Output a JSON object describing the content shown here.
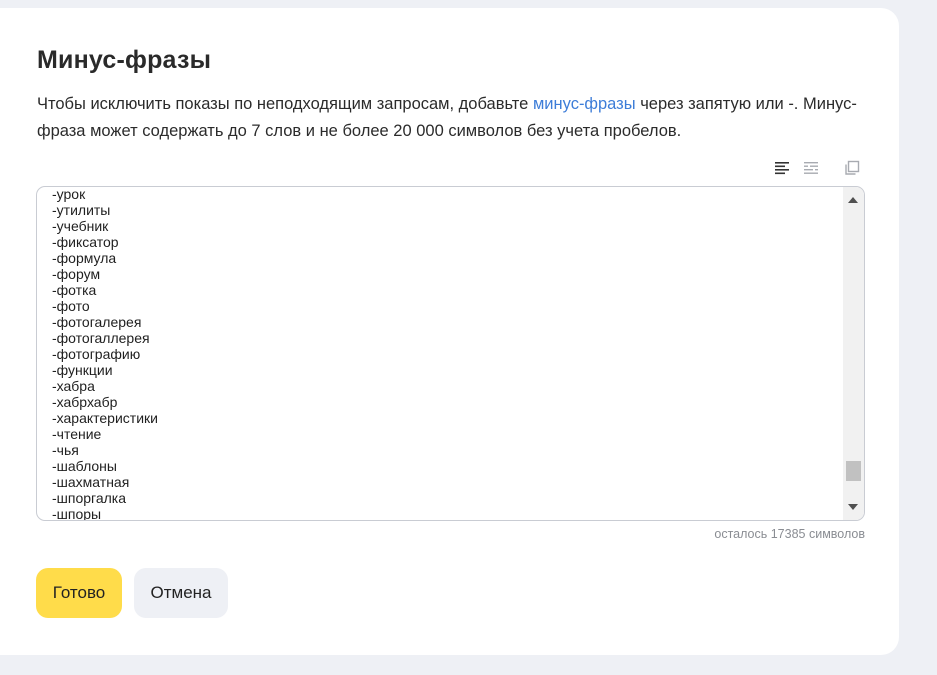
{
  "dialog": {
    "title": "Минус-фразы",
    "description_before": "Чтобы исключить показы по неподходящим запросам, добавьте ",
    "description_link": "минус-фразы",
    "description_after": " через запятую или -. Минус-фраза может содержать до 7 слов и не более 20 000 символов без учета пробелов."
  },
  "toolbar": {
    "icons": [
      "align-list-icon",
      "align-inline-icon",
      "copy-icon"
    ]
  },
  "editor": {
    "lines": [
      "-урок",
      "-утилиты",
      "-учебник",
      "-фиксатор",
      "-формула",
      "-форум",
      "-фотка",
      "-фото",
      "-фотогалерея",
      "-фотогаллерея",
      "-фотографию",
      "-функции",
      "-хабра",
      "-хабрхабр",
      "-характеристики",
      "-чтение",
      "-чья",
      "-шаблоны",
      "-шахматная",
      "-шпоргалка",
      "-шпоры"
    ],
    "scroll_position": 0.93
  },
  "counter": {
    "text": "осталось 17385 символов"
  },
  "buttons": {
    "done_label": "Готово",
    "cancel_label": "Отмена"
  },
  "colors": {
    "accent_button": "#ffdc4a",
    "link": "#3d7dd8",
    "page_background": "#eef0f5"
  }
}
